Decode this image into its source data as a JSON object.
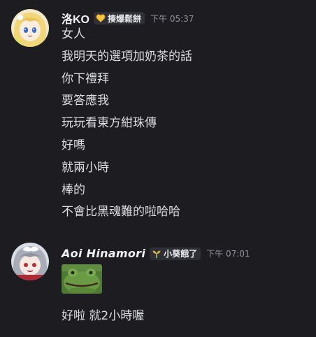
{
  "messages": [
    {
      "author": "洛KO",
      "role_tag": "揍爆鬆餅",
      "role_icon": "heart-icon",
      "timestamp": "下午 05:37",
      "lines": [
        "女人",
        "我明天的選項加奶茶的話",
        "你下禮拜",
        "要答應我",
        "玩玩看東方紺珠傳",
        "好嗎",
        "就兩小時",
        "棒的",
        "不會比黑魂難的啦哈哈"
      ]
    },
    {
      "author": "Aoi Hinamori",
      "role_tag": "小葵餓了",
      "role_icon": "sprout-icon",
      "timestamp": "下午 07:01",
      "attachment": "frog-image",
      "lines": [
        "好啦 就2小時喔"
      ]
    }
  ],
  "colors": {
    "background": "#1c1c21",
    "username": "#f2f3f5",
    "message_text": "#dcdde1",
    "timestamp": "#94959c",
    "tag_background": "#2e3035",
    "heart_icon": "#f5c542",
    "sprout_icon": "#e0b64a"
  }
}
